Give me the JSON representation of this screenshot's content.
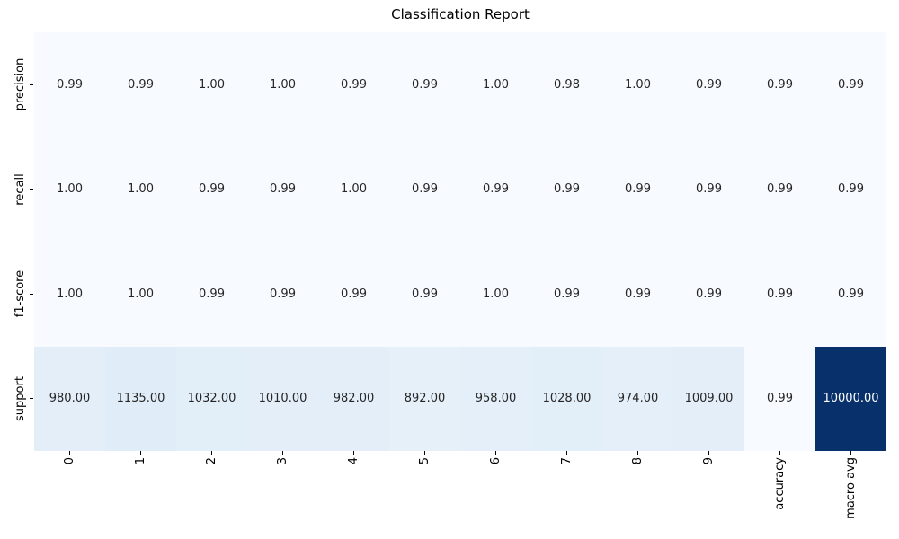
{
  "figure": {
    "background": "#ffffff"
  },
  "chart_data": {
    "type": "heatmap",
    "title": "Classification Report",
    "row_labels": [
      "precision",
      "recall",
      "f1-score",
      "support"
    ],
    "col_labels": [
      "0",
      "1",
      "2",
      "3",
      "4",
      "5",
      "6",
      "7",
      "8",
      "9",
      "accuracy",
      "macro avg"
    ],
    "values": [
      [
        0.99,
        0.99,
        1.0,
        1.0,
        0.99,
        0.99,
        1.0,
        0.98,
        1.0,
        0.99,
        0.99,
        0.99
      ],
      [
        1.0,
        1.0,
        0.99,
        0.99,
        1.0,
        0.99,
        0.99,
        0.99,
        0.99,
        0.99,
        0.99,
        0.99
      ],
      [
        1.0,
        1.0,
        0.99,
        0.99,
        0.99,
        0.99,
        1.0,
        0.99,
        0.99,
        0.99,
        0.99,
        0.99
      ],
      [
        980.0,
        1135.0,
        1032.0,
        1010.0,
        982.0,
        892.0,
        958.0,
        1028.0,
        974.0,
        1009.0,
        0.99,
        10000.0
      ]
    ],
    "value_decimals": 2,
    "vmin": 0,
    "vmax": 10000,
    "colormap": {
      "name": "Blues",
      "anchors": [
        "#f7fbff",
        "#deebf7",
        "#c6dbef",
        "#9ecae1",
        "#6baed6",
        "#4292c6",
        "#2171b5",
        "#08519c",
        "#08306b"
      ]
    },
    "annot_color_dark": "#262626",
    "annot_color_light": "#ffffff",
    "tick_color": "#000000",
    "grid": false,
    "legend_position": "none"
  }
}
